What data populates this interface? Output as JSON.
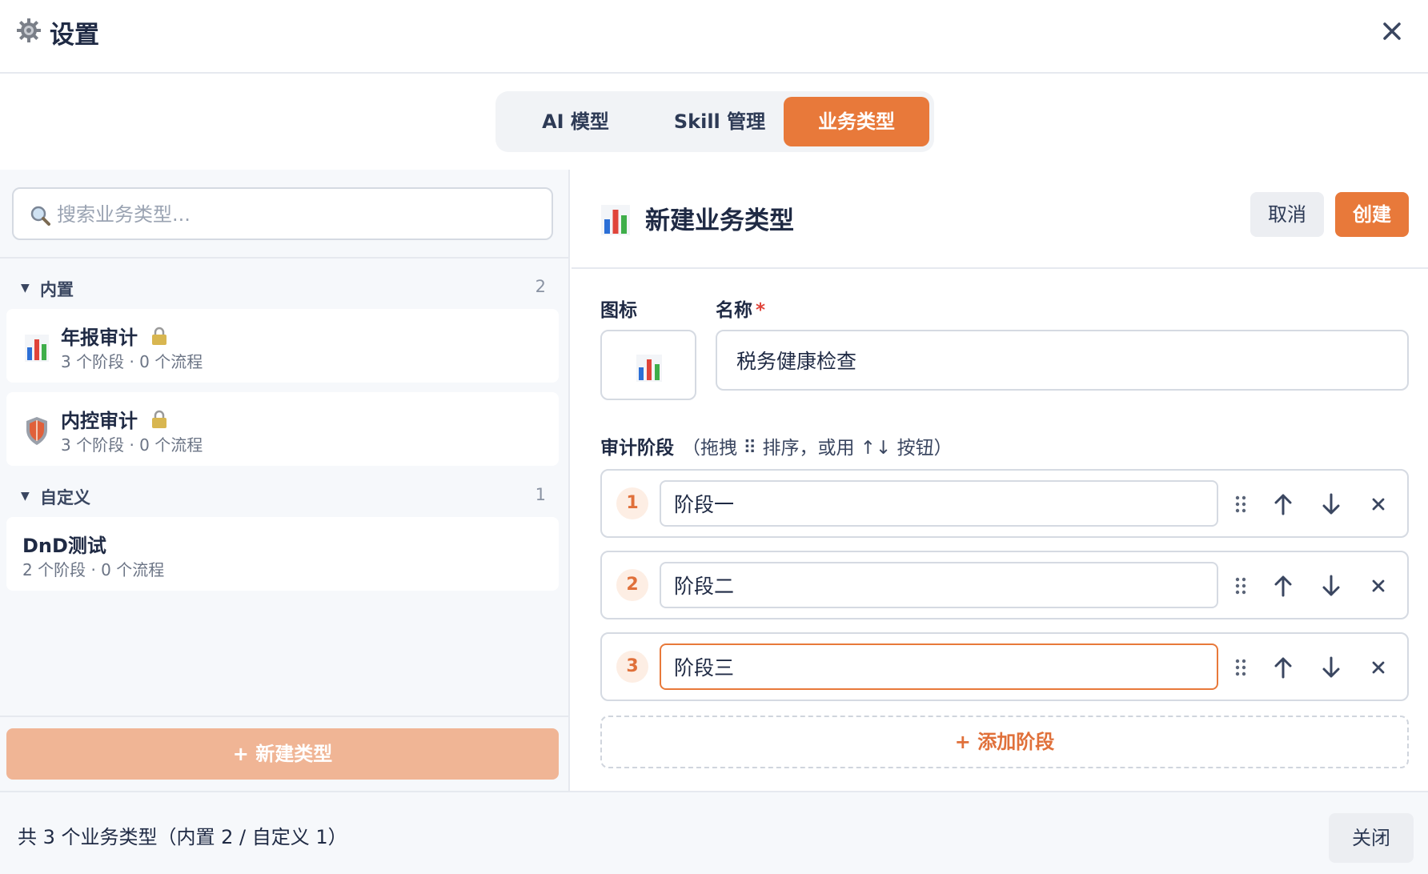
{
  "header": {
    "title": "设置",
    "icon": "gear-icon",
    "close_icon": "close-icon"
  },
  "tabs": [
    {
      "label": "AI 模型",
      "active": false
    },
    {
      "label": "Skill 管理",
      "active": false
    },
    {
      "label": "业务类型",
      "active": true
    }
  ],
  "left": {
    "search_placeholder": "搜索业务类型...",
    "groups": {
      "builtin": {
        "label": "内置",
        "count": "2",
        "items": [
          {
            "title": "年报审计",
            "subtitle": "3 个阶段 · 0 个流程",
            "icon": "bar-chart-icon",
            "locked": true
          },
          {
            "title": "内控审计",
            "subtitle": "3 个阶段 · 0 个流程",
            "icon": "shield-icon",
            "locked": true
          }
        ]
      },
      "custom": {
        "label": "自定义",
        "count": "1",
        "items": [
          {
            "title": "DnD测试",
            "subtitle": "2 个阶段 · 0 个流程"
          }
        ]
      }
    },
    "new_type_label": "+ 新建类型"
  },
  "right": {
    "title": "新建业务类型",
    "cancel_label": "取消",
    "create_label": "创建",
    "icon_label": "图标",
    "name_label": "名称",
    "required_mark": "*",
    "name_value": "税务健康检查",
    "stages_label": "审计阶段",
    "stages_hint": "（拖拽 ⠿ 排序，或用 ↑↓ 按钮）",
    "stages": [
      {
        "num": "1",
        "value": "阶段一"
      },
      {
        "num": "2",
        "value": "阶段二"
      },
      {
        "num": "3",
        "value": "阶段三"
      }
    ],
    "add_stage_label": "+ 添加阶段"
  },
  "footer": {
    "summary": "共 3 个业务类型（内置 2 / 自定义 1）",
    "close_label": "关闭"
  },
  "colors": {
    "accent": "#e8793a",
    "accent_light": "#f0b595"
  }
}
